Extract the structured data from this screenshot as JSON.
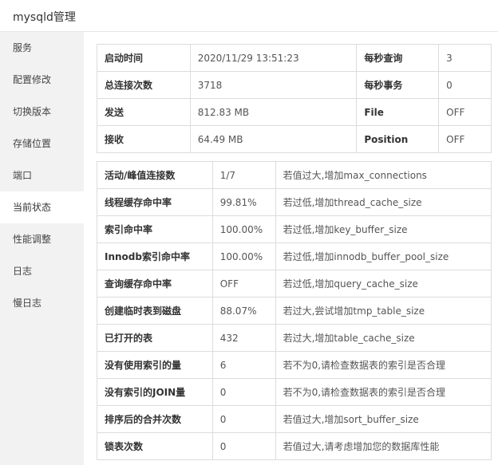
{
  "app": {
    "title": "mysqld管理"
  },
  "sidebar": {
    "items": [
      {
        "label": "服务",
        "active": false
      },
      {
        "label": "配置修改",
        "active": false
      },
      {
        "label": "切换版本",
        "active": false
      },
      {
        "label": "存储位置",
        "active": false
      },
      {
        "label": "端口",
        "active": false
      },
      {
        "label": "当前状态",
        "active": true
      },
      {
        "label": "性能调整",
        "active": false
      },
      {
        "label": "日志",
        "active": false
      },
      {
        "label": "慢日志",
        "active": false
      }
    ]
  },
  "summary": {
    "rows": [
      {
        "label1": "启动时间",
        "value1": "2020/11/29 13:51:23",
        "label2": "每秒查询",
        "value2": "3"
      },
      {
        "label1": "总连接次数",
        "value1": "3718",
        "label2": "每秒事务",
        "value2": "0"
      },
      {
        "label1": "发送",
        "value1": "812.83 MB",
        "label2": "File",
        "value2": "OFF"
      },
      {
        "label1": "接收",
        "value1": "64.49 MB",
        "label2": "Position",
        "value2": "OFF"
      }
    ]
  },
  "status": {
    "rows": [
      {
        "name": "活动/峰值连接数",
        "value": "1/7",
        "advice": "若值过大,增加max_connections"
      },
      {
        "name": "线程缓存命中率",
        "value": "99.81%",
        "advice": "若过低,增加thread_cache_size"
      },
      {
        "name": "索引命中率",
        "value": "100.00%",
        "advice": "若过低,增加key_buffer_size"
      },
      {
        "name": "Innodb索引命中率",
        "value": "100.00%",
        "advice": "若过低,增加innodb_buffer_pool_size"
      },
      {
        "name": "查询缓存命中率",
        "value": "OFF",
        "advice": "若过低,增加query_cache_size"
      },
      {
        "name": "创建临时表到磁盘",
        "value": "88.07%",
        "advice": "若过大,尝试增加tmp_table_size"
      },
      {
        "name": "已打开的表",
        "value": "432",
        "advice": "若过大,增加table_cache_size"
      },
      {
        "name": "没有使用索引的量",
        "value": "6",
        "advice": "若不为0,请检查数据表的索引是否合理"
      },
      {
        "name": "没有索引的JOIN量",
        "value": "0",
        "advice": "若不为0,请检查数据表的索引是否合理"
      },
      {
        "name": "排序后的合并次数",
        "value": "0",
        "advice": "若值过大,增加sort_buffer_size"
      },
      {
        "name": "锁表次数",
        "value": "0",
        "advice": "若值过大,请考虑增加您的数据库性能"
      }
    ]
  }
}
